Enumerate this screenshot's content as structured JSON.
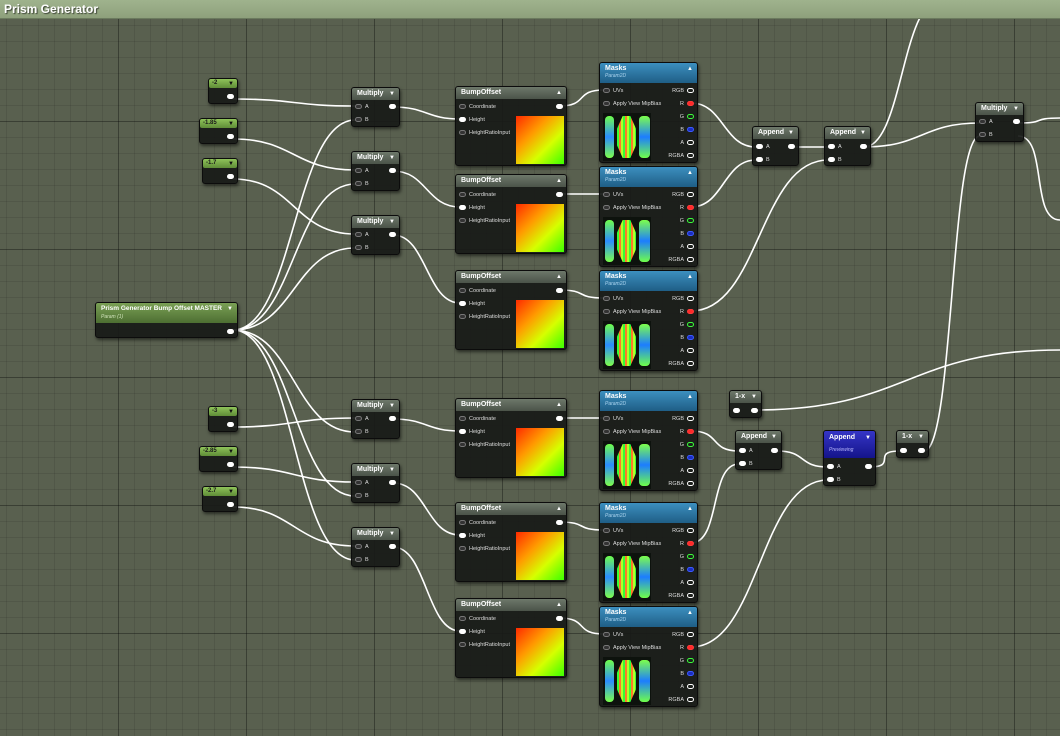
{
  "window": {
    "title": "Prism Generator"
  },
  "constants": [
    "-2",
    "-1.85",
    "-1.7",
    "-3",
    "-2.85",
    "-2.7"
  ],
  "master": {
    "label": "Prism Generator Bump Offset MASTER",
    "sub": "Param (1)"
  },
  "multiply": {
    "title": "Multiply",
    "pin_a": "A",
    "pin_b": "B"
  },
  "bump_offset": {
    "title": "BumpOffset",
    "pins": [
      "Coordinate",
      "Height",
      "HeightRatioInput"
    ]
  },
  "masks": {
    "title": "Masks",
    "sub": "Param2D",
    "pins_in": [
      "UVs",
      "Apply View MipBias"
    ],
    "pins_out": [
      "RGB",
      "R",
      "G",
      "B",
      "A",
      "RGBA"
    ]
  },
  "append": {
    "title": "Append",
    "pin_a": "A",
    "pin_b": "B"
  },
  "append_preview": {
    "title": "Append",
    "sub": "Previewing"
  },
  "one_minus": {
    "title": "1-x"
  },
  "colors": {
    "title_bar": "#94a782",
    "param_green": "#7fb24c",
    "masks_blue": "#2f7fb0",
    "preview_blue": "#2a2ab0",
    "wire": "#ffffff"
  },
  "icons": [
    "collapse-arrow-icon",
    "pin-icon"
  ]
}
